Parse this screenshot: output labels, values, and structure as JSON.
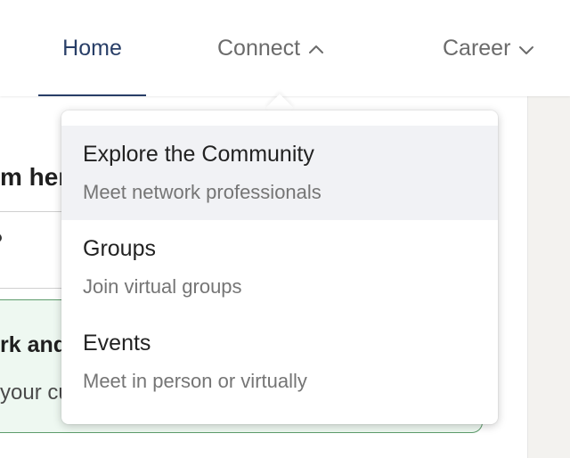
{
  "nav": {
    "home_label": "Home",
    "connect_label": "Connect",
    "career_label": "Career"
  },
  "background": {
    "heading_fragment": "m her",
    "card_title_fragment": "rk and",
    "card_sub_fragment": "your cu"
  },
  "dropdown": {
    "items": [
      {
        "title": "Explore the Community",
        "subtitle": "Meet network professionals"
      },
      {
        "title": "Groups",
        "subtitle": "Join virtual groups"
      },
      {
        "title": "Events",
        "subtitle": "Meet in person or virtually"
      }
    ]
  },
  "colors": {
    "nav_active": "#283e67",
    "nav_inactive": "#6b6b6b",
    "menu_hover_bg": "#f1f2f5",
    "card_border": "#5d9c6c",
    "card_bg": "#eef8f1"
  }
}
